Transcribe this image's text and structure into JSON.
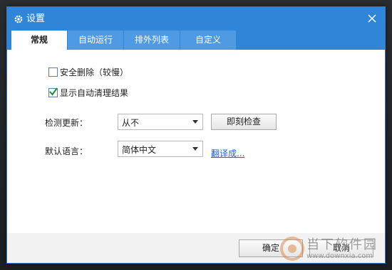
{
  "window": {
    "title": "设置",
    "icons": {
      "title": "gear-icon",
      "close": "close-icon"
    },
    "colors": {
      "titlebar": "#2f86d8",
      "tab_inactive": "#4f9be3",
      "link": "#2a62c9"
    }
  },
  "tabs": [
    {
      "label": "常规",
      "active": true
    },
    {
      "label": "自动运行",
      "active": false
    },
    {
      "label": "排外列表",
      "active": false
    },
    {
      "label": "自定义",
      "active": false
    }
  ],
  "general": {
    "safe_delete": {
      "label": "安全删除（较慢）",
      "checked": false
    },
    "show_results": {
      "label": "显示自动清理结果",
      "checked": true
    },
    "update_check": {
      "label": "检测更新：",
      "selected": "从不",
      "button": "即刻检查"
    },
    "language": {
      "label": "默认语言：",
      "selected": "简体中文",
      "link": "翻译成..."
    }
  },
  "footer": {
    "ok": "确定",
    "cancel": "取消"
  },
  "watermark": {
    "name": "当下软件园",
    "url": "www.downxia.com"
  }
}
